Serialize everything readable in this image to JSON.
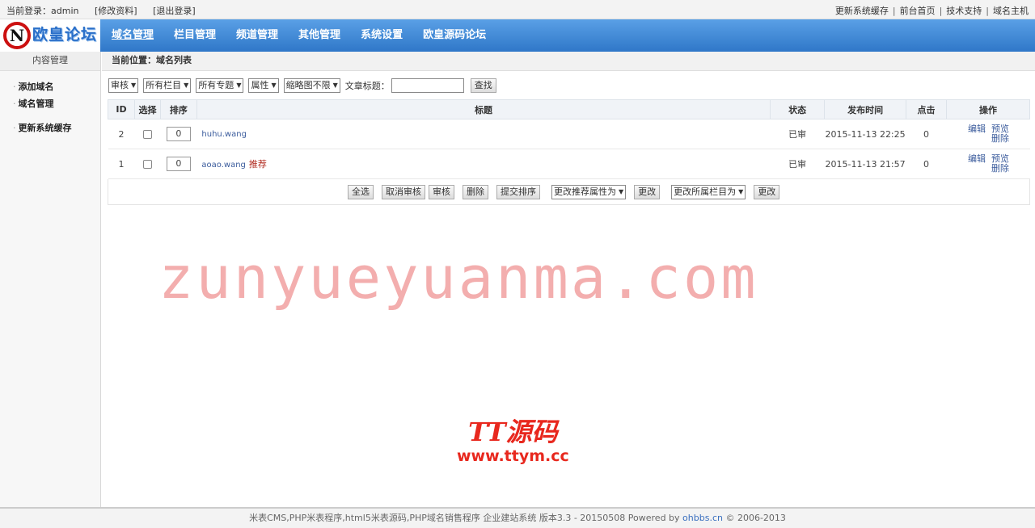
{
  "topbar": {
    "login_text": "当前登录：admin",
    "edit_profile": "[修改资料]",
    "logout": "[退出登录]",
    "right_links": [
      "更新系统缓存",
      "前台首页",
      "技术支持",
      "域名主机"
    ]
  },
  "logo": {
    "mark": "N",
    "text": "欧皇论坛"
  },
  "nav": {
    "items": [
      "域名管理",
      "栏目管理",
      "频道管理",
      "其他管理",
      "系统设置",
      "欧皇源码论坛"
    ]
  },
  "sidebar": {
    "title": "内容管理",
    "items": [
      "添加域名",
      "域名管理",
      "更新系统缓存"
    ]
  },
  "breadcrumb": "当前位置：域名列表",
  "filters": {
    "selects": [
      "审核",
      "所有栏目",
      "所有专题",
      "属性",
      "缩略图不限"
    ],
    "title_label": "文章标题：",
    "title_value": "",
    "search_button": "查找"
  },
  "table": {
    "headers": [
      "ID",
      "选择",
      "排序",
      "标题",
      "状态",
      "发布时间",
      "点击",
      "操作"
    ],
    "rows": [
      {
        "id": "2",
        "sort": "0",
        "title": "huhu.wang",
        "tag": "",
        "status": "已审",
        "time": "2015-11-13 22:25",
        "clicks": "0"
      },
      {
        "id": "1",
        "sort": "0",
        "title": "aoao.wang",
        "tag": "推荐",
        "status": "已审",
        "time": "2015-11-13 21:57",
        "clicks": "0"
      }
    ],
    "ops": [
      "编辑",
      "预览",
      "删除"
    ]
  },
  "actions": {
    "select_all": "全选",
    "cancel_review": "取消审核",
    "review": "审核",
    "delete": "删除",
    "submit_sort": "提交排序",
    "recommend_select": "更改推荐属性为",
    "change1": "更改",
    "category_select": "更改所属栏目为",
    "change2": "更改"
  },
  "watermark": {
    "main": "zunyueyuanma.com",
    "brand": "TT源码",
    "url": "www.ttym.cc"
  },
  "footer": {
    "text": "米表CMS,PHP米表程序,html5米表源码,PHP域名销售程序 企业建站系统 版本3.3 - 20150508 Powered by ",
    "link": "ohbbs.cn",
    "copy": " © 2006-2013"
  }
}
